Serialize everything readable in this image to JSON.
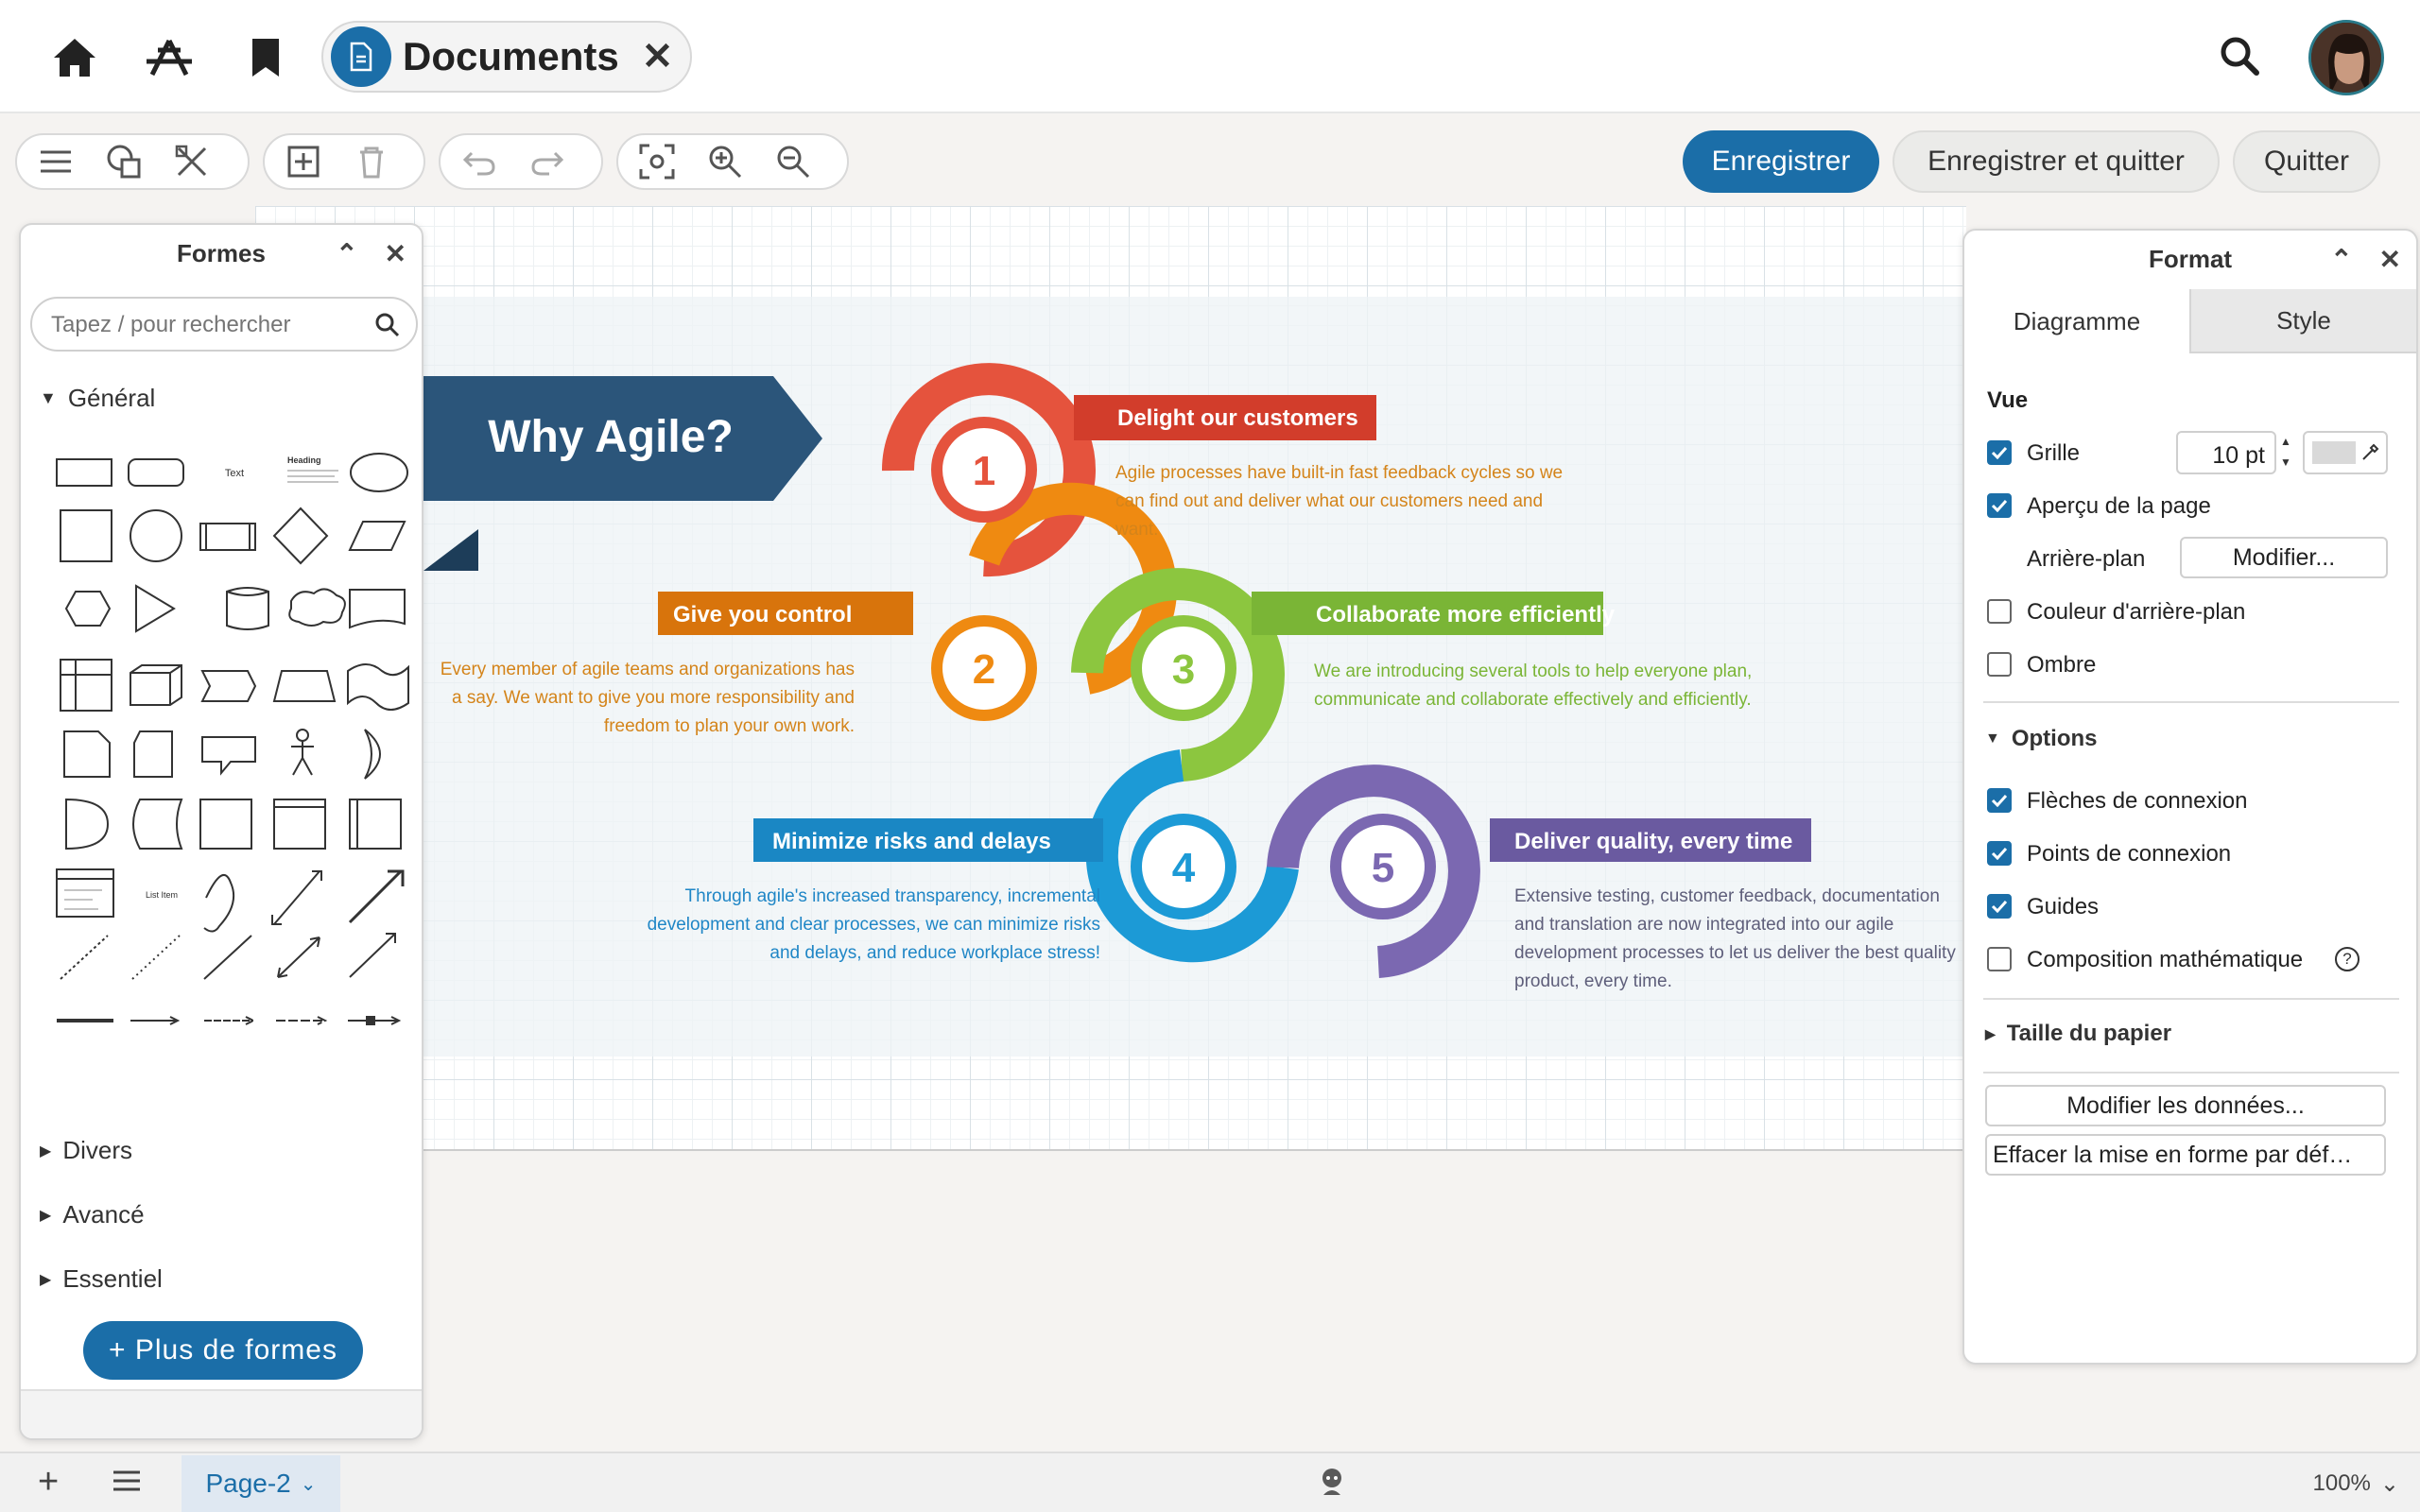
{
  "header": {
    "document_title": "Documents",
    "icons": [
      "home-icon",
      "apps-icon",
      "bookmark-icon",
      "search-icon"
    ]
  },
  "toolbar": {
    "save": "Enregistrer",
    "save_quit": "Enregistrer et quitter",
    "quit": "Quitter"
  },
  "shapes_panel": {
    "title": "Formes",
    "search_placeholder": "Tapez / pour rechercher",
    "section_general": "Général",
    "section_misc": "Divers",
    "section_advanced": "Avancé",
    "section_basic": "Essentiel",
    "more_shapes": "+ Plus de formes",
    "shape_text": "Text",
    "shape_heading": "Heading",
    "shape_list_item": "List Item"
  },
  "format_panel": {
    "title": "Format",
    "tab_diagram": "Diagramme",
    "tab_style": "Style",
    "view_heading": "Vue",
    "grid": "Grille",
    "grid_size": "10 pt",
    "page_view": "Aperçu de la page",
    "background": "Arrière-plan",
    "edit_background": "Modifier...",
    "background_color": "Couleur d'arrière-plan",
    "shadow": "Ombre",
    "options_heading": "Options",
    "connection_arrows": "Flèches de connexion",
    "connection_points": "Points de connexion",
    "guides": "Guides",
    "math_typesetting": "Composition mathématique",
    "paper_size": "Taille du papier",
    "edit_data": "Modifier les données...",
    "clear_default_style": "Effacer la mise en forme par déf…",
    "checked": {
      "grid": true,
      "page_view": true,
      "background_color": false,
      "shadow": false,
      "connection_arrows": true,
      "connection_points": true,
      "guides": true,
      "math_typesetting": false
    }
  },
  "diagram": {
    "title": "Why Agile?",
    "steps": [
      {
        "num": "1",
        "label": "Delight our customers",
        "text": "Agile processes have built-in fast feedback cycles so we can find out and deliver what our customers need and want.",
        "color": "#e5533d",
        "text_color": "#d4841a"
      },
      {
        "num": "2",
        "label": "Give you control",
        "text": "Every member of agile teams and organizations has a say. We want to give you more responsibility and freedom to plan your own work.",
        "color": "#ef8a11",
        "text_color": "#d4841a"
      },
      {
        "num": "3",
        "label": "Collaborate more efficiently",
        "text": "We are introducing several tools to help everyone plan, communicate and collaborate effectively and efficiently.",
        "color": "#8cc63f",
        "text_color": "#7ab536"
      },
      {
        "num": "4",
        "label": "Minimize risks and delays",
        "text": "Through agile's increased transparency, incremental development and clear processes, we can minimize risks and delays, and reduce workplace stress!",
        "color": "#1c9ad6",
        "text_color": "#1f86c6"
      },
      {
        "num": "5",
        "label": "Deliver quality, every time",
        "text": "Extensive testing, customer feedback, documentation and translation are now integrated into our agile development processes to let us deliver the best quality product, every time.",
        "color": "#7b68b1",
        "text_color": "#5e5e7a"
      }
    ]
  },
  "footer": {
    "page_tab": "Page-2",
    "zoom": "100%"
  }
}
